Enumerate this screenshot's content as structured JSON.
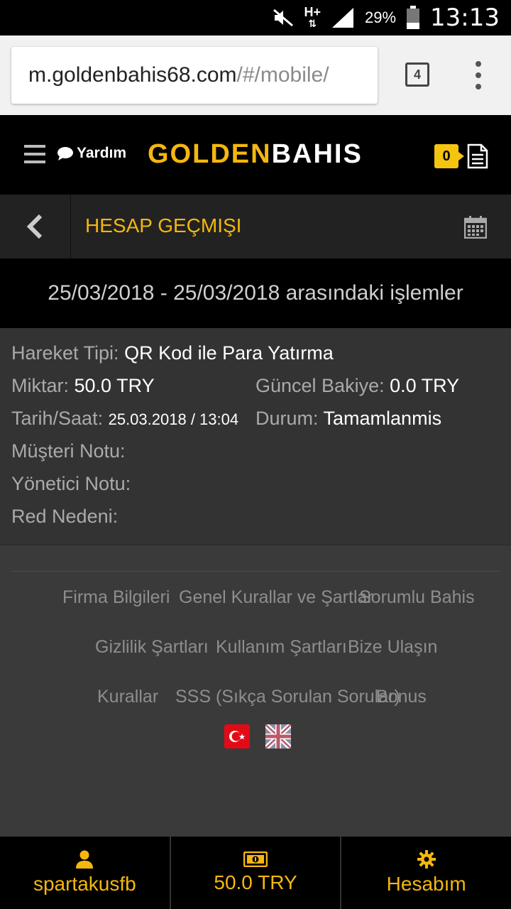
{
  "status_bar": {
    "battery_percent": "29%",
    "time": "13:13",
    "network": "H+"
  },
  "browser": {
    "url_host": "m.goldenbahis68.com",
    "url_path": "/#/mobile/",
    "tab_count": "4"
  },
  "header": {
    "help_label": "Yardım",
    "logo_gold": "GOLDEN",
    "logo_white": "BAHIS",
    "betslip_count": "0"
  },
  "page": {
    "title": "HESAP GEÇMIŞI",
    "date_range": "25/03/2018 - 25/03/2018 arasındaki işlemler"
  },
  "transaction": {
    "type_label": "Hareket Tipi:",
    "type_value": "QR Kod ile Para Yatırma",
    "amount_label": "Miktar:",
    "amount_value": "50.0 TRY",
    "balance_label": "Güncel Bakiye:",
    "balance_value": "0.0 TRY",
    "datetime_label": "Tarih/Saat:",
    "datetime_value": "25.03.2018 / 13:04",
    "status_label": "Durum:",
    "status_value": "Tamamlanmis",
    "customer_note_label": "Müşteri Notu:",
    "admin_note_label": "Yönetici Notu:",
    "reject_reason_label": "Red Nedeni:"
  },
  "footer": {
    "links": [
      "Firma Bilgileri",
      "Genel Kurallar ve Şartlar",
      "Sorumlu Bahis",
      "Gizlilik Şartları",
      "Kullanım Şartları",
      "Bize Ulaşın",
      "Kurallar",
      "SSS (Sıkça Sorulan Sorular)",
      "Bonus"
    ]
  },
  "bottom_bar": {
    "username": "spartakusfb",
    "balance": "50.0 TRY",
    "account_label": "Hesabım"
  },
  "colors": {
    "accent": "#f5b70f",
    "background": "#3a3a3a",
    "header": "#000000"
  }
}
